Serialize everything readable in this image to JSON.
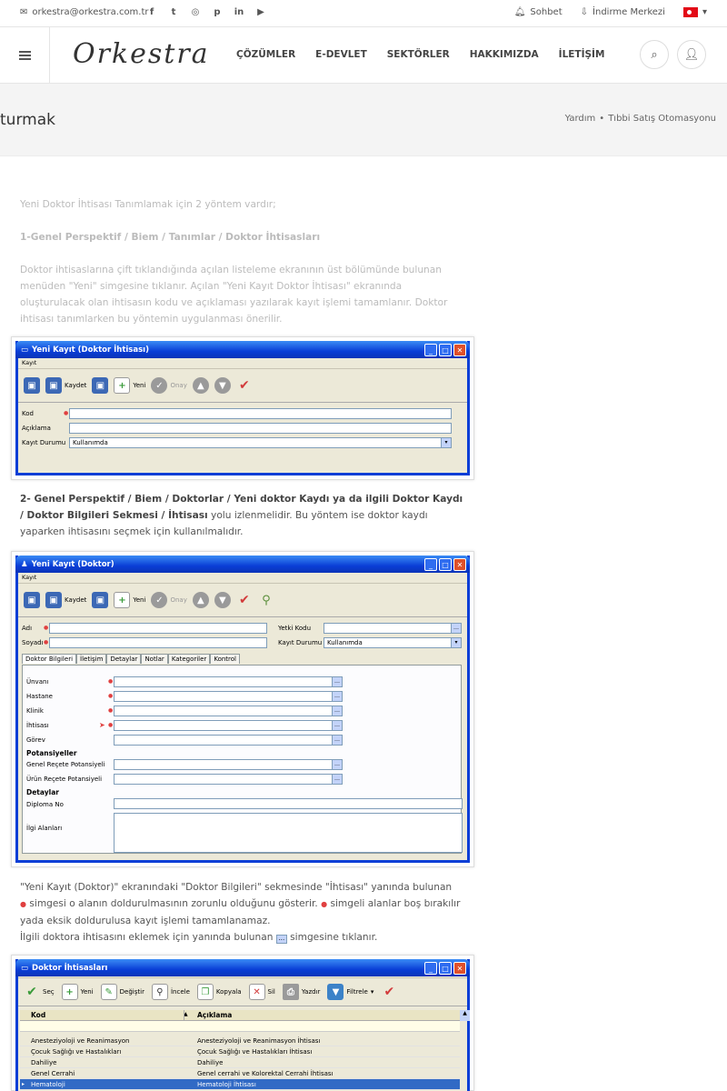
{
  "topbar": {
    "email": "orkestra@orkestra.com.tr",
    "social_icons": [
      "facebook-icon",
      "twitter-icon",
      "instagram-icon",
      "pinterest-icon",
      "linkedin-icon",
      "youtube-icon"
    ],
    "chat_label": "Sohbet",
    "download_label": "İndirme Merkezi"
  },
  "header": {
    "logo": "Orkestra",
    "nav": [
      "ÇÖZÜMLER",
      "E-DEVLET",
      "SEKTÖRLER",
      "HAKKIMIZDA",
      "İLETİŞİM"
    ]
  },
  "band": {
    "title": "turmak",
    "crumb_1": "Yardım",
    "crumb_sep": "•",
    "crumb_2": "Tıbbi Satış Otomasyonu"
  },
  "article": {
    "intro": "Yeni Doktor İhtisası Tanımlamak için 2 yöntem vardır;",
    "method1_title": "1-Genel Perspektif / Biem / Tanımlar / Doktor İhtisasları",
    "method1_body": "Doktor ihtisaslarına çift tıklandığında açılan listeleme ekranının üst bölümünde bulunan menüden \"Yeni\" simgesine tıklanır. Açılan \"Yeni Kayıt Doktor İhtisası\" ekranında oluşturulacak olan ihtisasın kodu ve açıklaması yazılarak kayıt işlemi tamamlanır. Doktor ihtisası tanımlarken bu yöntemin uygulanması önerilir.",
    "method2_title": "2- Genel Perspektif / Biem / Doktorlar / Yeni doktor Kaydı ya da ilgili Doktor Kaydı / Doktor Bilgileri Sekmesi / İhtisası",
    "method2_body": " yolu izlenmelidir. Bu yöntem ise doktor kaydı yaparken ihtisasını seçmek için kullanılmalıdır.",
    "note_1": "\"Yeni  Kayıt (Doktor)\" ekranındaki \"Doktor Bilgileri\" sekmesinde \"İhtisası\" yanında bulunan",
    "note_2a": " simgesi o alanın doldurulmasının zorunlu olduğunu gösterir.",
    "note_2b": " simgeli alanlar boş bırakılır",
    "note_3": "yada eksik doldurulusa kayıt işlemi tamamlanamaz.",
    "note_4a": "İlgili doktora ihtisasını eklemek için yanında bulunan",
    "note_4b": " simgesine tıklanır."
  },
  "shot1": {
    "title": "Yeni Kayıt (Doktor İhtisası)",
    "menu": "Kayıt",
    "buttons": [
      "Kaydet",
      "Yeni",
      "Onay"
    ],
    "fields": [
      {
        "label": "Kod",
        "value": ""
      },
      {
        "label": "Açıklama",
        "value": ""
      },
      {
        "label": "Kayıt Durumu",
        "value": "Kullanımda"
      }
    ]
  },
  "shot2": {
    "title": "Yeni Kayıt (Doktor)",
    "menu": "Kayıt",
    "buttons": [
      "Kaydet",
      "Yeni",
      "Onay"
    ],
    "adi": "Adı",
    "soyadi": "Soyadı",
    "yetki_kodu": "Yetki Kodu",
    "kayit_durumu": "Kayıt Durumu",
    "kayit_durumu_value": "Kullanımda",
    "tabs": [
      "Doktor Bilgileri",
      "İletişim",
      "Detaylar",
      "Notlar",
      "Kategoriler",
      "Kontrol"
    ],
    "fields": [
      "Ünvanı",
      "Hastane",
      "Klinik",
      "İhtisası",
      "Görev"
    ],
    "section_potansiyeller": "Potansiyeller",
    "pot_fields": [
      "Genel Reçete Potansiyeli",
      "Ürün Reçete Potansiyeli"
    ],
    "section_detaylar": "Detaylar",
    "diploma": "Diploma No",
    "ilgi": "İlgi Alanları"
  },
  "shot3": {
    "title": "Doktor İhtisasları",
    "buttons": [
      "Seç",
      "Yeni",
      "Değiştir",
      "İncele",
      "Kopyala",
      "Sil",
      "Yazdır",
      "Filtrele"
    ],
    "columns": [
      "Kod",
      "Açıklama"
    ],
    "rows": [
      [
        "Anesteziyoloji ve Reanimasyon",
        "Anesteziyoloji ve Reanimasyon İhtisası"
      ],
      [
        "Çocuk Sağlığı ve Hastalıkları",
        "Çocuk Sağlığı ve Hastalıkları İhtisası"
      ],
      [
        "Dahiliye",
        "Dahiliye"
      ],
      [
        "Genel Cerrahi",
        "Genel cerrahi ve Kolorektal Cerrahi İhtisası"
      ],
      [
        "Hematoloji",
        "Hematoloji İhtisası"
      ]
    ]
  }
}
